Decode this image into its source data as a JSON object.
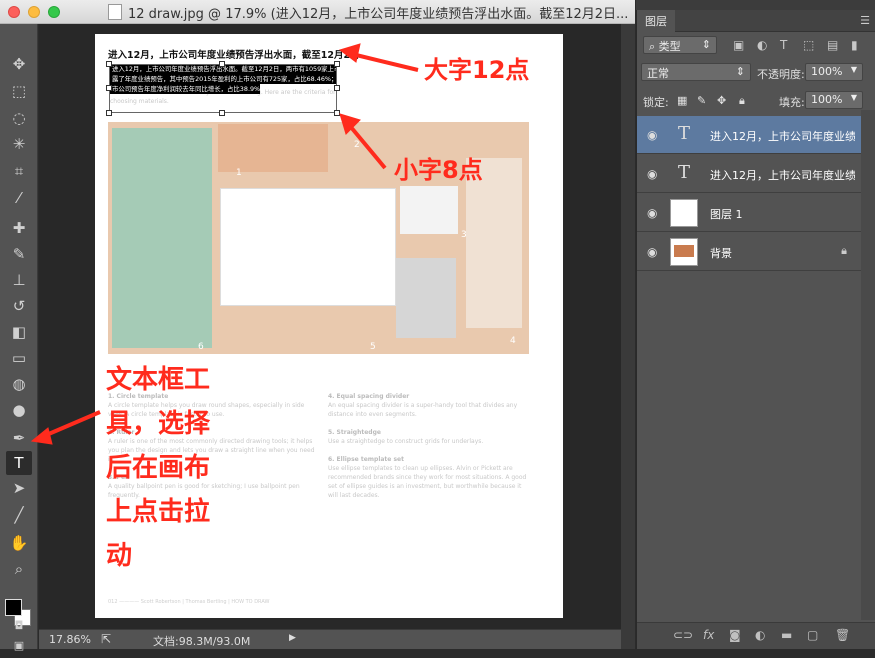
{
  "window": {
    "title": "12 draw.jpg @ 17.9% (进入12月，上市公司年度业绩预告浮出水面。截至12月2日..."
  },
  "tools": [
    {
      "name": "move-tool",
      "glyph": "✥"
    },
    {
      "name": "marquee-tool",
      "glyph": "⬚"
    },
    {
      "name": "lasso-tool",
      "glyph": "◌"
    },
    {
      "name": "magic-wand-tool",
      "glyph": "✳"
    },
    {
      "name": "crop-tool",
      "glyph": "⌗"
    },
    {
      "name": "eyedropper-tool",
      "glyph": "⁄"
    },
    {
      "name": "healing-brush-tool",
      "glyph": "✚"
    },
    {
      "name": "brush-tool",
      "glyph": "✎"
    },
    {
      "name": "clone-stamp-tool",
      "glyph": "⊥"
    },
    {
      "name": "history-brush-tool",
      "glyph": "↺"
    },
    {
      "name": "eraser-tool",
      "glyph": "◧"
    },
    {
      "name": "gradient-tool",
      "glyph": "▭"
    },
    {
      "name": "blur-tool",
      "glyph": "◍"
    },
    {
      "name": "dodge-tool",
      "glyph": "●"
    },
    {
      "name": "pen-tool",
      "glyph": "✒"
    },
    {
      "name": "type-tool",
      "glyph": "T"
    },
    {
      "name": "path-selection-tool",
      "glyph": "➤"
    },
    {
      "name": "line-tool",
      "glyph": "╱"
    },
    {
      "name": "hand-tool",
      "glyph": "✋"
    },
    {
      "name": "zoom-tool",
      "glyph": "⌕"
    }
  ],
  "document": {
    "heading": "进入12月，上市公司年度业绩预告浮出水面，截至12月2日",
    "selected_lines": [
      "进入12月，上市公司年度业绩预告浮出水面。截至12月2日，两市有1059家上市公司披",
      "露了年度业绩预告，其中预告2015年盈利的上市公司有725家，占比68.46%；412家上",
      "市公司预告年度净利润较去年同比增长，占比38.9%。"
    ],
    "faint_lines": [
      "kinds of tools would be best for your next drawing. Here are the criteria for",
      "choosing materials."
    ],
    "photo_numbers": [
      "1",
      "2",
      "3",
      "4",
      "5",
      "6"
    ],
    "col_left": [
      {
        "head": "1. Circle template",
        "body": "A circle template helps you draw round shapes, especially in side view. A circle template is faster to use."
      },
      {
        "head": "2. Ruler",
        "body": "A ruler is one of the most commonly directed drawing tools; it helps you plan the design and lets you draw a straight line when you need it."
      },
      {
        "head": "3. Pen",
        "body": "A quality ballpoint pen is good for sketching; I use ballpoint pen frequently."
      }
    ],
    "col_right": [
      {
        "head": "4. Equal spacing divider",
        "body": "An equal spacing divider is a super-handy tool that divides any distance into even segments."
      },
      {
        "head": "5. Straightedge",
        "body": "Use a straightedge to construct grids for underlays."
      },
      {
        "head": "6. Ellipse template set",
        "body": "Use ellipse templates to clean up ellipses. Alvin or Pickett are recommended brands since they work for most situations. A good set of ellipse guides is an investment, but worthwhile because it will last decades."
      }
    ],
    "footer": "012 ———— Scott Robertson | Thomas Bertling | HOW TO DRAW"
  },
  "annotations": {
    "big_text": "大字12点",
    "small_text": "小字8点",
    "tool_note_lines": [
      "文本框工",
      "具，选择",
      "后在画布",
      "上点击拉",
      "动"
    ]
  },
  "status": {
    "zoom": "17.86%",
    "doc": "文档:98.3M/93.0M"
  },
  "layers_panel": {
    "tab": "图层",
    "filter_label": "类型",
    "blend_mode": "正常",
    "opacity_label": "不透明度:",
    "opacity_value": "100%",
    "lock_label": "锁定:",
    "fill_label": "填充:",
    "fill_value": "100%",
    "layers": [
      {
        "name": "进入12月，上市公司年度业绩...",
        "kind": "text",
        "selected": true
      },
      {
        "name": "进入12月，上市公司年度业绩...",
        "kind": "text",
        "selected": false
      },
      {
        "name": "图层 1",
        "kind": "white",
        "selected": false
      },
      {
        "name": "背景",
        "kind": "image",
        "selected": false,
        "locked": true
      }
    ]
  },
  "colors": {
    "annotation_red": "#ff2b1d",
    "selected_layer": "#5d7aa0",
    "ui_gray": "#535353"
  }
}
